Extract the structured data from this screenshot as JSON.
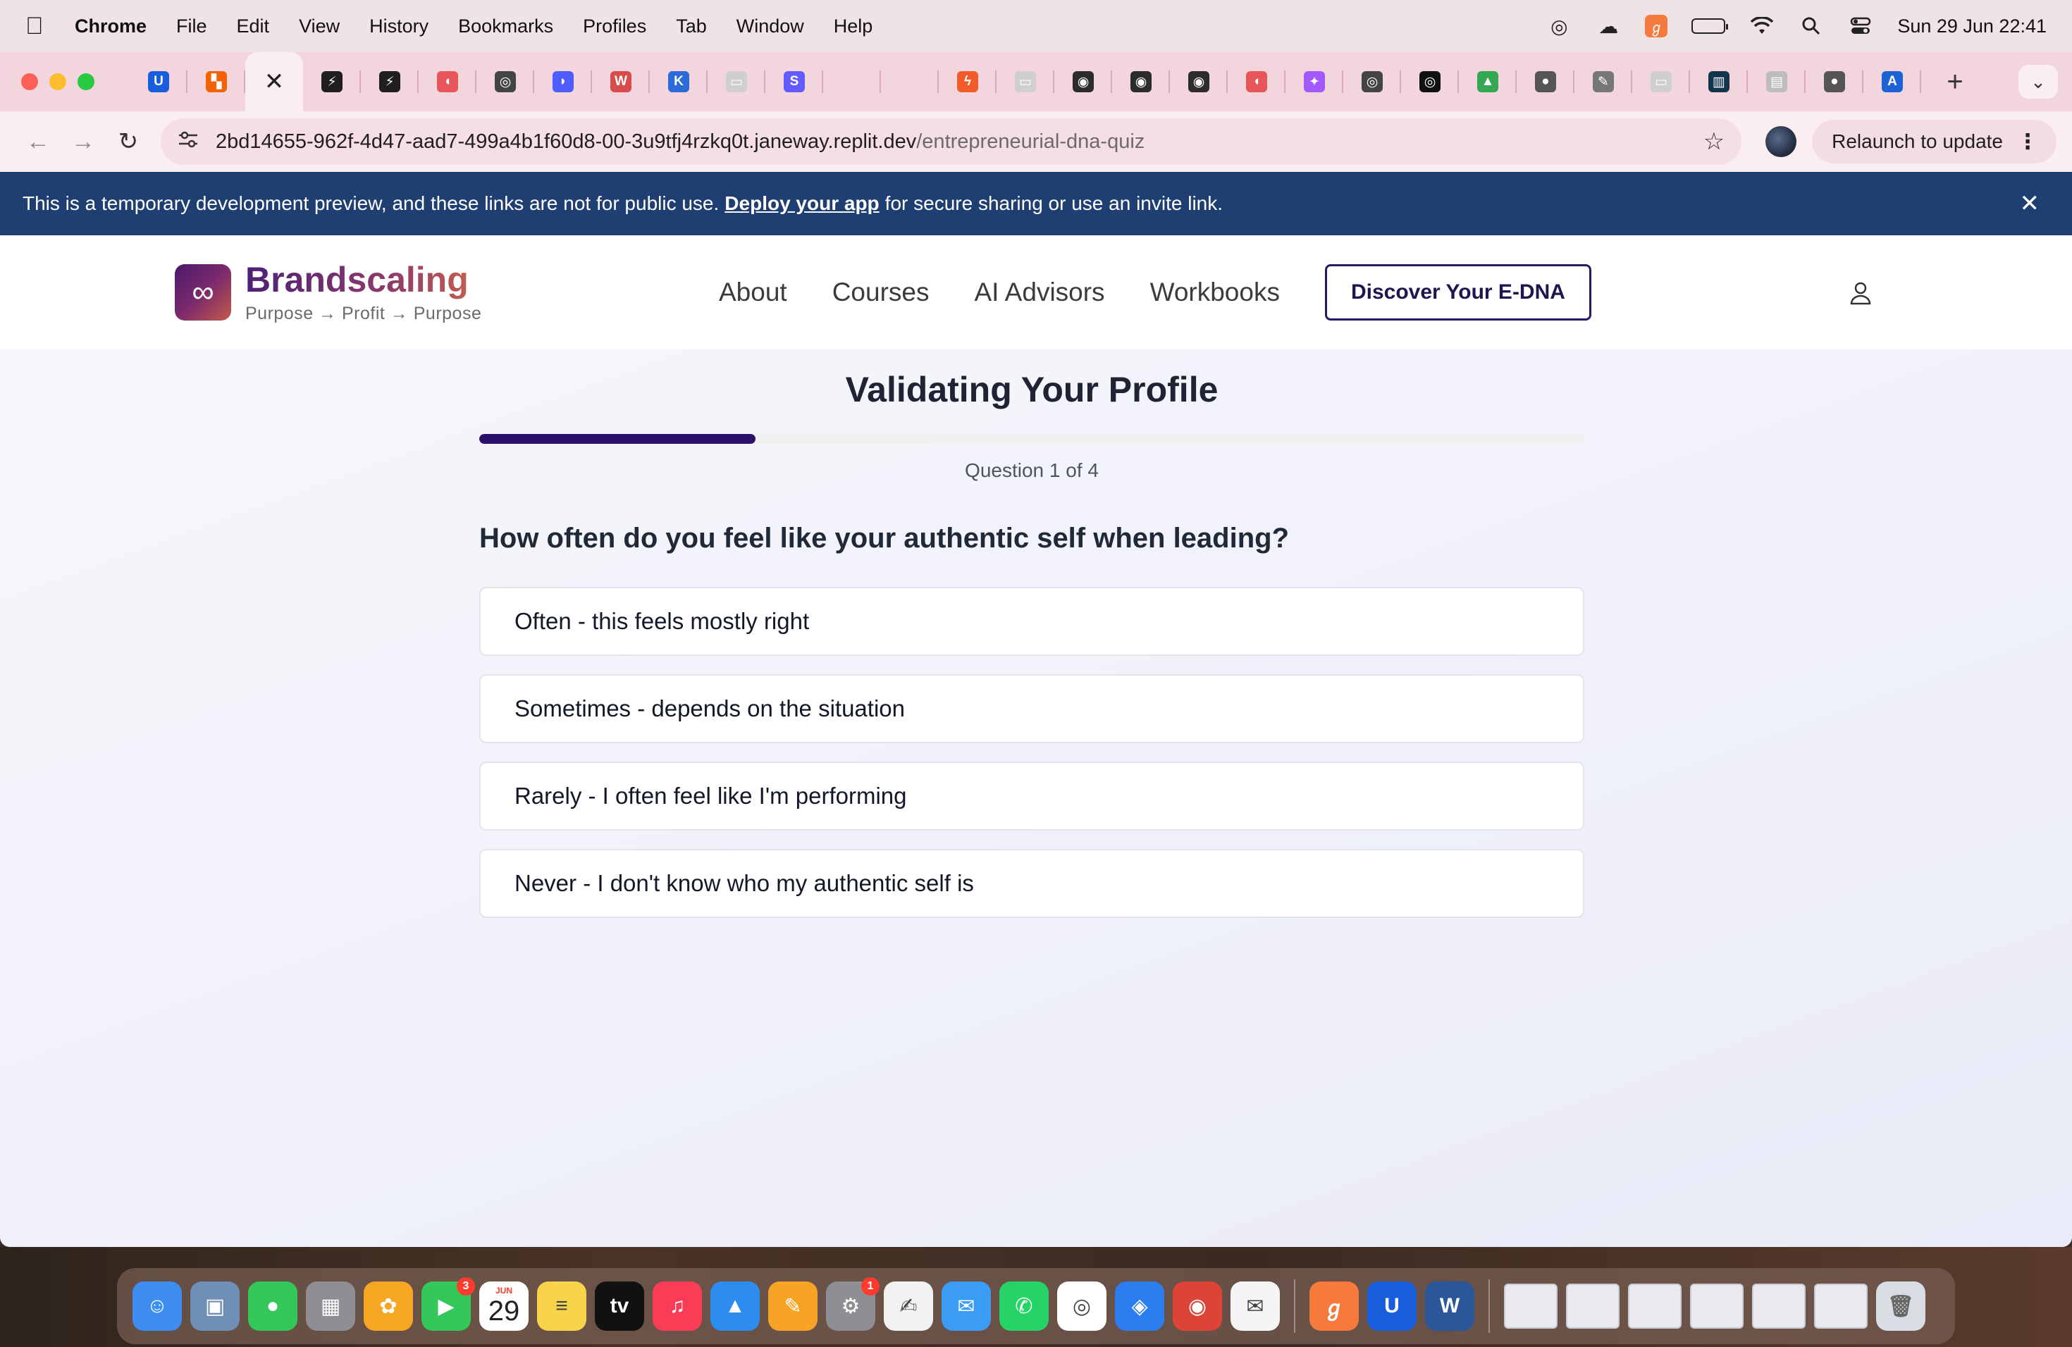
{
  "menubar": {
    "app_name": "Chrome",
    "items": [
      "File",
      "Edit",
      "View",
      "History",
      "Bookmarks",
      "Profiles",
      "Tab",
      "Window",
      "Help"
    ],
    "datetime": "Sun 29 Jun  22:41"
  },
  "tabs": {
    "favicons": [
      {
        "icon": "bitwarden-icon",
        "color": "#175ddc",
        "glyph": "U"
      },
      {
        "icon": "replit-icon",
        "color": "#f26207",
        "glyph": "▚"
      },
      {
        "icon": "close-icon",
        "color": "",
        "glyph": "✕"
      },
      {
        "icon": "terminal-icon",
        "color": "#1f1f1f",
        "glyph": "⚡"
      },
      {
        "icon": "terminal-icon",
        "color": "#1f1f1f",
        "glyph": "⚡"
      },
      {
        "icon": "lovable-icon",
        "color": "#e6565a",
        "glyph": "◖"
      },
      {
        "icon": "chatgpt-icon",
        "color": "#444444",
        "glyph": "◎"
      },
      {
        "icon": "app-icon",
        "color": "#4f5dff",
        "glyph": "◗"
      },
      {
        "icon": "webflow-icon",
        "color": "#d94c4c",
        "glyph": "W"
      },
      {
        "icon": "k-icon",
        "color": "#2a6bd8",
        "glyph": "K"
      },
      {
        "icon": "page-icon",
        "color": "#cfcfcf",
        "glyph": "▭"
      },
      {
        "icon": "stripe-icon",
        "color": "#635bff",
        "glyph": "S"
      },
      {
        "icon": "blank-icon",
        "color": "",
        "glyph": ""
      },
      {
        "icon": "blank-icon",
        "color": "",
        "glyph": ""
      },
      {
        "icon": "bolt-icon",
        "color": "#f25c2a",
        "glyph": "ϟ"
      },
      {
        "icon": "page-icon",
        "color": "#cfcfcf",
        "glyph": "▭"
      },
      {
        "icon": "owl-icon",
        "color": "#2c2c2c",
        "glyph": "◉"
      },
      {
        "icon": "owl-icon",
        "color": "#2c2c2c",
        "glyph": "◉"
      },
      {
        "icon": "owl-icon",
        "color": "#2c2c2c",
        "glyph": "◉"
      },
      {
        "icon": "lovable-icon",
        "color": "#e6565a",
        "glyph": "◖"
      },
      {
        "icon": "figma-icon",
        "color": "#a259ff",
        "glyph": "✦"
      },
      {
        "icon": "chatgpt-icon",
        "color": "#444444",
        "glyph": "◎"
      },
      {
        "icon": "chatgpt-icon",
        "color": "#111111",
        "glyph": "◎"
      },
      {
        "icon": "drive-icon",
        "color": "#34a853",
        "glyph": "▲"
      },
      {
        "icon": "globe-icon",
        "color": "#555555",
        "glyph": "●"
      },
      {
        "icon": "edit-icon",
        "color": "#777777",
        "glyph": "✎"
      },
      {
        "icon": "page-icon",
        "color": "#cfcfcf",
        "glyph": "▭"
      },
      {
        "icon": "chart-icon",
        "color": "#12344d",
        "glyph": "▥"
      },
      {
        "icon": "page-icon",
        "color": "#bdbdbd",
        "glyph": "▤"
      },
      {
        "icon": "globe-icon",
        "color": "#555555",
        "glyph": "●"
      },
      {
        "icon": "a-icon",
        "color": "#1e63d6",
        "glyph": "A"
      }
    ]
  },
  "toolbar": {
    "url_host": "2bd14655-962f-4d47-aad7-499a4b1f60d8-00-3u9tfj4rzkq0t.janeway.replit.dev",
    "url_path": "/entrepreneurial-dna-quiz",
    "relaunch_label": "Relaunch to update"
  },
  "banner": {
    "text_before": "This is a temporary development preview, and these links are not for public use.",
    "link": "Deploy your app",
    "text_after": "for secure sharing or use an invite link."
  },
  "site": {
    "brand_name": "Brandscaling",
    "brand_tagline": "Purpose → Profit → Purpose",
    "nav": [
      "About",
      "Courses",
      "AI Advisors",
      "Workbooks"
    ],
    "cta_label": "Discover Your E-DNA"
  },
  "quiz": {
    "title": "Validating Your Profile",
    "progress_fraction": 0.25,
    "progress_label": "Question 1 of 4",
    "question": "How often do you feel like your authentic self when leading?",
    "options": [
      "Often - this feels mostly right",
      "Sometimes - depends on the situation",
      "Rarely - I often feel like I'm performing",
      "Never - I don't know who my authentic self is"
    ]
  },
  "dock": {
    "apps": [
      {
        "icon": "finder-icon",
        "color": "#3d8ef0",
        "glyph": "☺"
      },
      {
        "icon": "preview-icon",
        "color": "#6f8fb5",
        "glyph": "▣"
      },
      {
        "icon": "messages-icon",
        "color": "#34c759",
        "glyph": "●"
      },
      {
        "icon": "launchpad-icon",
        "color": "#8e8e93",
        "glyph": "▦"
      },
      {
        "icon": "photos-icon",
        "color": "#f5a623",
        "glyph": "✿"
      },
      {
        "icon": "facetime-icon",
        "color": "#34c759",
        "glyph": "▶",
        "badge": "3"
      },
      {
        "icon": "calendar-icon",
        "color": "#ffffff",
        "glyph": "",
        "cal_month": "JUN",
        "cal_day": "29"
      },
      {
        "icon": "notes-icon",
        "color": "#f7d44a",
        "glyph": "≡"
      },
      {
        "icon": "tv-icon",
        "color": "#111111",
        "glyph": "tv"
      },
      {
        "icon": "music-icon",
        "color": "#fa3c57",
        "glyph": "♫"
      },
      {
        "icon": "keynote-icon",
        "color": "#2d8cf0",
        "glyph": "▲"
      },
      {
        "icon": "pages-icon",
        "color": "#f7a325",
        "glyph": "✎"
      },
      {
        "icon": "settings-icon",
        "color": "#8e8e93",
        "glyph": "⚙",
        "badge": "1"
      },
      {
        "icon": "scrivener-icon",
        "color": "#f2f2f2",
        "glyph": "✍"
      },
      {
        "icon": "mail-icon",
        "color": "#3b9cf5",
        "glyph": "✉"
      },
      {
        "icon": "whatsapp-icon",
        "color": "#25d366",
        "glyph": "✆"
      },
      {
        "icon": "chatgpt-icon",
        "color": "#ffffff",
        "glyph": "◎"
      },
      {
        "icon": "safari-icon",
        "color": "#2c7df0",
        "glyph": "◈"
      },
      {
        "icon": "chrome-icon",
        "color": "#db4437",
        "glyph": "◉"
      },
      {
        "icon": "mailer-icon",
        "color": "#f5f5f5",
        "glyph": "✉"
      }
    ],
    "pinned": [
      {
        "icon": "app-icon",
        "color": "#f57a3c",
        "glyph": "ℊ"
      },
      {
        "icon": "bitwarden-icon",
        "color": "#175ddc",
        "glyph": "U"
      },
      {
        "icon": "word-icon",
        "color": "#2b579a",
        "glyph": "W"
      }
    ]
  }
}
